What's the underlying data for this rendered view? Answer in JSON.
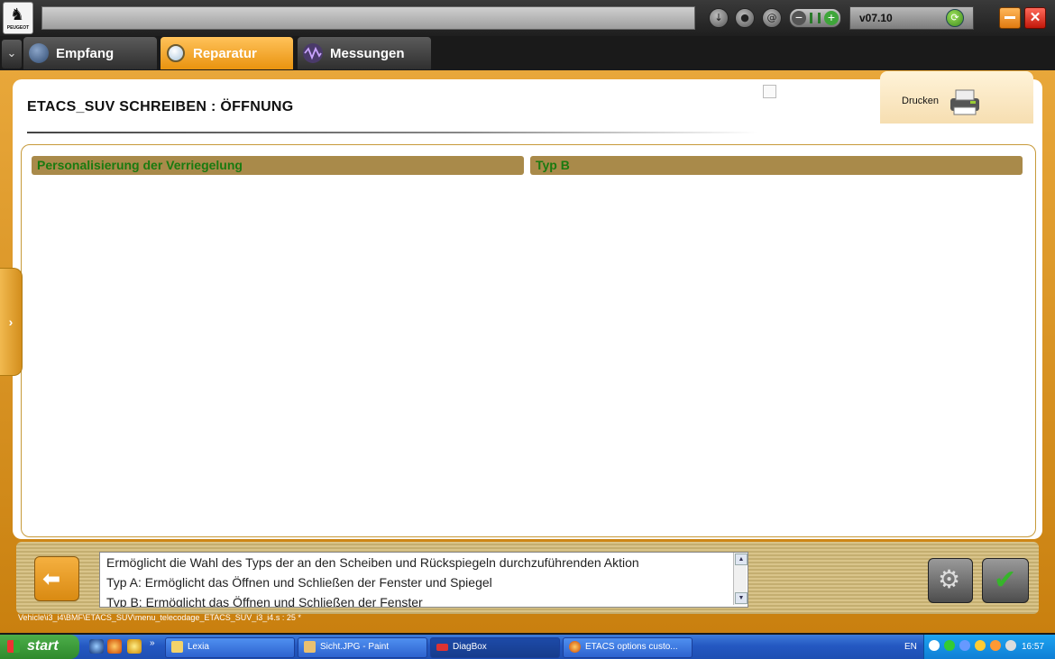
{
  "header": {
    "brand": "PEUGEOT",
    "version": "v07.10"
  },
  "tabs": [
    {
      "label": "Empfang"
    },
    {
      "label": "Reparatur"
    },
    {
      "label": "Messungen"
    }
  ],
  "page": {
    "title": "ETACS_SUV  SCHREIBEN : ÖFFNUNG",
    "print_label": "Drucken"
  },
  "table": {
    "headers": [
      "Personalisierung der Verriegelung",
      "Typ B"
    ]
  },
  "description": {
    "lines": [
      "Ermöglicht die Wahl des Typs der an den Scheiben und Rückspiegeln durchzuführenden Aktion",
      "Typ A: Ermöglicht das Öffnen und Schließen der Fenster und Spiegel",
      "Typ B: Ermöglicht das Öffnen und Schließen der Fenster"
    ]
  },
  "status_path": "Vehicle\\i3_i4\\BMF\\ETACS_SUV\\menu_telecodage_ETACS_SUV_i3_i4.s : 25 *",
  "taskbar": {
    "start_label": "start",
    "buttons": [
      {
        "label": "Lexia"
      },
      {
        "label": "Sicht.JPG - Paint"
      },
      {
        "label": "DiagBox"
      },
      {
        "label": "ETACS options custo..."
      }
    ],
    "language": "EN",
    "clock": "16:57"
  },
  "colors": {
    "accent_orange": "#e9930f",
    "header_cell": "#a98a4a",
    "header_text_green": "#1a7a10"
  }
}
